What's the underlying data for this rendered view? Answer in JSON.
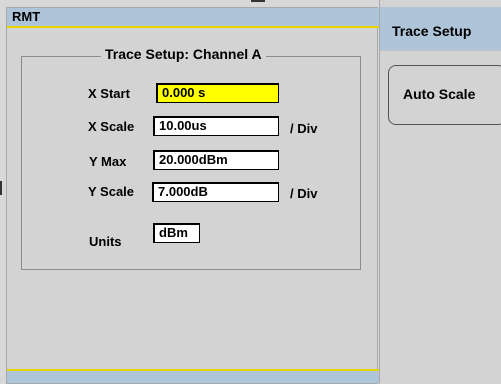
{
  "status": {
    "label": "RMT"
  },
  "panel": {
    "title": "Trace Setup: Channel A",
    "fields": [
      {
        "label": "X Start",
        "value": "0.000 s",
        "unit": ""
      },
      {
        "label": "X Scale",
        "value": "10.00us",
        "unit": "/ Div"
      },
      {
        "label": "Y Max",
        "value": "20.000dBm",
        "unit": ""
      },
      {
        "label": "Y Scale",
        "value": "7.000dB",
        "unit": "/ Div"
      },
      {
        "label": "Units",
        "value": "dBm",
        "unit": ""
      }
    ]
  },
  "menu": {
    "title": "Trace Setup",
    "softkeys": [
      {
        "label": "Auto Scale"
      }
    ]
  },
  "colors": {
    "highlight": "#ffff00",
    "title_bar": "#aec4d8",
    "accent_line": "#e6d600",
    "background": "#d3d3d3"
  }
}
